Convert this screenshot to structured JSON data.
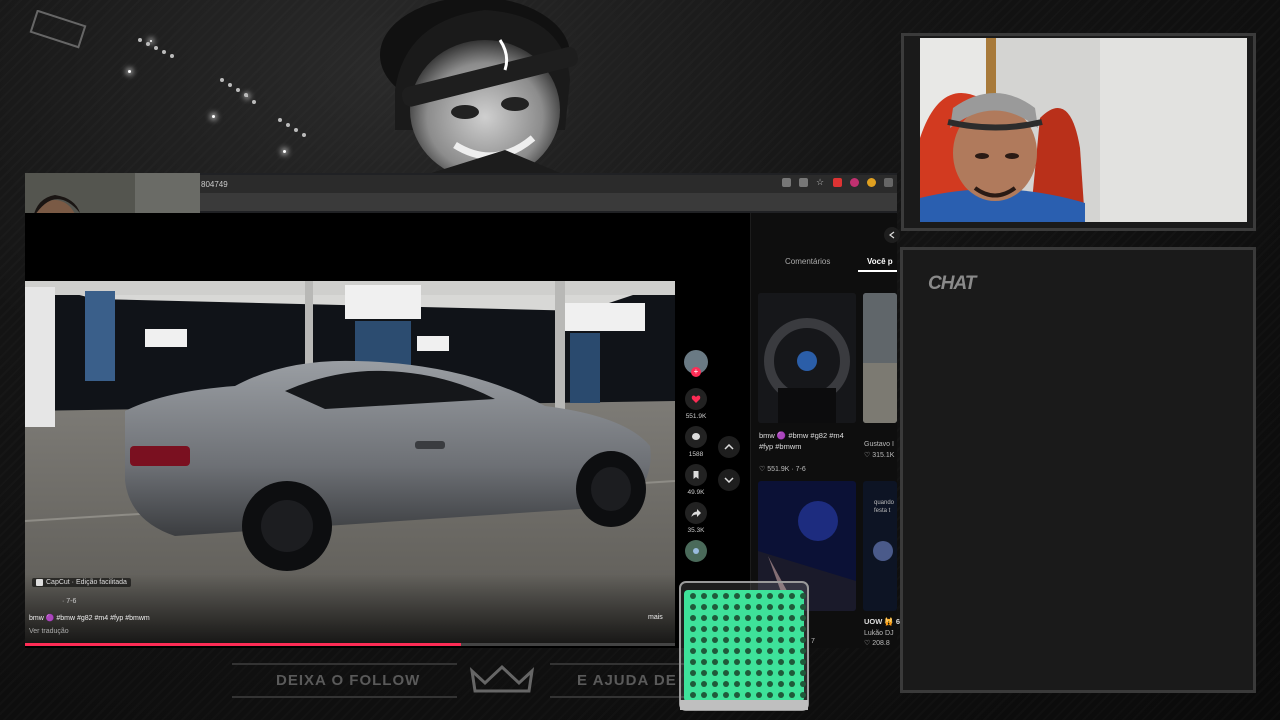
{
  "browser": {
    "url_fragment": "804749"
  },
  "tiktok": {
    "video": {
      "capcut_badge": "CapCut · Edição facilitada",
      "date": "· 7-6",
      "description": "bmw 🟣 #bmw #g82 #m4 #fyp #bmwm",
      "more": "mais",
      "translate": "Ver tradução",
      "progress_pct": 67
    },
    "actions": {
      "likes": "551.9K",
      "comments": "1588",
      "saves": "49.9K",
      "shares": "35.3K"
    },
    "sidebar": {
      "tabs": [
        "Comentários",
        "Você p"
      ],
      "active_tab": 1,
      "items": [
        {
          "title": "bmw 🟣 #bmw #g82 #m4 #fyp #bmwm",
          "stats": "♡ 551.9K · 7-6"
        },
        {
          "title": "Gustavo I",
          "stats": "♡ 315.1K"
        },
        {
          "title": "7",
          "stats": ""
        },
        {
          "title": "UOW 🙀 6",
          "author": "Lukão DJ",
          "stats": "♡ 208.8"
        }
      ],
      "card4_overlay": "quando festa t"
    }
  },
  "overlay": {
    "chat_title": "CHAT",
    "banner_left": "DEIXA O FOLLOW",
    "banner_right": "E AJUDA DE"
  },
  "colors": {
    "accent": "#fe2c55",
    "jar_green": "#3ee29a"
  }
}
